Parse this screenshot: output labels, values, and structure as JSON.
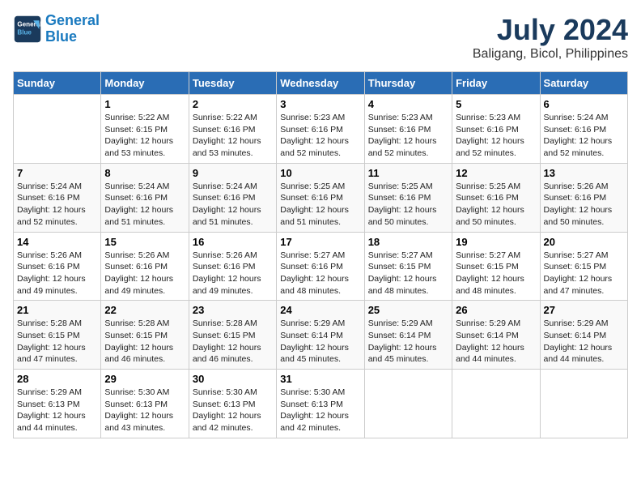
{
  "logo": {
    "line1": "General",
    "line2": "Blue"
  },
  "title": "July 2024",
  "subtitle": "Baligang, Bicol, Philippines",
  "days_header": [
    "Sunday",
    "Monday",
    "Tuesday",
    "Wednesday",
    "Thursday",
    "Friday",
    "Saturday"
  ],
  "weeks": [
    [
      {
        "day": "",
        "sunrise": "",
        "sunset": "",
        "daylight": ""
      },
      {
        "day": "1",
        "sunrise": "Sunrise: 5:22 AM",
        "sunset": "Sunset: 6:15 PM",
        "daylight": "Daylight: 12 hours and 53 minutes."
      },
      {
        "day": "2",
        "sunrise": "Sunrise: 5:22 AM",
        "sunset": "Sunset: 6:16 PM",
        "daylight": "Daylight: 12 hours and 53 minutes."
      },
      {
        "day": "3",
        "sunrise": "Sunrise: 5:23 AM",
        "sunset": "Sunset: 6:16 PM",
        "daylight": "Daylight: 12 hours and 52 minutes."
      },
      {
        "day": "4",
        "sunrise": "Sunrise: 5:23 AM",
        "sunset": "Sunset: 6:16 PM",
        "daylight": "Daylight: 12 hours and 52 minutes."
      },
      {
        "day": "5",
        "sunrise": "Sunrise: 5:23 AM",
        "sunset": "Sunset: 6:16 PM",
        "daylight": "Daylight: 12 hours and 52 minutes."
      },
      {
        "day": "6",
        "sunrise": "Sunrise: 5:24 AM",
        "sunset": "Sunset: 6:16 PM",
        "daylight": "Daylight: 12 hours and 52 minutes."
      }
    ],
    [
      {
        "day": "7",
        "sunrise": "Sunrise: 5:24 AM",
        "sunset": "Sunset: 6:16 PM",
        "daylight": "Daylight: 12 hours and 52 minutes."
      },
      {
        "day": "8",
        "sunrise": "Sunrise: 5:24 AM",
        "sunset": "Sunset: 6:16 PM",
        "daylight": "Daylight: 12 hours and 51 minutes."
      },
      {
        "day": "9",
        "sunrise": "Sunrise: 5:24 AM",
        "sunset": "Sunset: 6:16 PM",
        "daylight": "Daylight: 12 hours and 51 minutes."
      },
      {
        "day": "10",
        "sunrise": "Sunrise: 5:25 AM",
        "sunset": "Sunset: 6:16 PM",
        "daylight": "Daylight: 12 hours and 51 minutes."
      },
      {
        "day": "11",
        "sunrise": "Sunrise: 5:25 AM",
        "sunset": "Sunset: 6:16 PM",
        "daylight": "Daylight: 12 hours and 50 minutes."
      },
      {
        "day": "12",
        "sunrise": "Sunrise: 5:25 AM",
        "sunset": "Sunset: 6:16 PM",
        "daylight": "Daylight: 12 hours and 50 minutes."
      },
      {
        "day": "13",
        "sunrise": "Sunrise: 5:26 AM",
        "sunset": "Sunset: 6:16 PM",
        "daylight": "Daylight: 12 hours and 50 minutes."
      }
    ],
    [
      {
        "day": "14",
        "sunrise": "Sunrise: 5:26 AM",
        "sunset": "Sunset: 6:16 PM",
        "daylight": "Daylight: 12 hours and 49 minutes."
      },
      {
        "day": "15",
        "sunrise": "Sunrise: 5:26 AM",
        "sunset": "Sunset: 6:16 PM",
        "daylight": "Daylight: 12 hours and 49 minutes."
      },
      {
        "day": "16",
        "sunrise": "Sunrise: 5:26 AM",
        "sunset": "Sunset: 6:16 PM",
        "daylight": "Daylight: 12 hours and 49 minutes."
      },
      {
        "day": "17",
        "sunrise": "Sunrise: 5:27 AM",
        "sunset": "Sunset: 6:16 PM",
        "daylight": "Daylight: 12 hours and 48 minutes."
      },
      {
        "day": "18",
        "sunrise": "Sunrise: 5:27 AM",
        "sunset": "Sunset: 6:15 PM",
        "daylight": "Daylight: 12 hours and 48 minutes."
      },
      {
        "day": "19",
        "sunrise": "Sunrise: 5:27 AM",
        "sunset": "Sunset: 6:15 PM",
        "daylight": "Daylight: 12 hours and 48 minutes."
      },
      {
        "day": "20",
        "sunrise": "Sunrise: 5:27 AM",
        "sunset": "Sunset: 6:15 PM",
        "daylight": "Daylight: 12 hours and 47 minutes."
      }
    ],
    [
      {
        "day": "21",
        "sunrise": "Sunrise: 5:28 AM",
        "sunset": "Sunset: 6:15 PM",
        "daylight": "Daylight: 12 hours and 47 minutes."
      },
      {
        "day": "22",
        "sunrise": "Sunrise: 5:28 AM",
        "sunset": "Sunset: 6:15 PM",
        "daylight": "Daylight: 12 hours and 46 minutes."
      },
      {
        "day": "23",
        "sunrise": "Sunrise: 5:28 AM",
        "sunset": "Sunset: 6:15 PM",
        "daylight": "Daylight: 12 hours and 46 minutes."
      },
      {
        "day": "24",
        "sunrise": "Sunrise: 5:29 AM",
        "sunset": "Sunset: 6:14 PM",
        "daylight": "Daylight: 12 hours and 45 minutes."
      },
      {
        "day": "25",
        "sunrise": "Sunrise: 5:29 AM",
        "sunset": "Sunset: 6:14 PM",
        "daylight": "Daylight: 12 hours and 45 minutes."
      },
      {
        "day": "26",
        "sunrise": "Sunrise: 5:29 AM",
        "sunset": "Sunset: 6:14 PM",
        "daylight": "Daylight: 12 hours and 44 minutes."
      },
      {
        "day": "27",
        "sunrise": "Sunrise: 5:29 AM",
        "sunset": "Sunset: 6:14 PM",
        "daylight": "Daylight: 12 hours and 44 minutes."
      }
    ],
    [
      {
        "day": "28",
        "sunrise": "Sunrise: 5:29 AM",
        "sunset": "Sunset: 6:13 PM",
        "daylight": "Daylight: 12 hours and 44 minutes."
      },
      {
        "day": "29",
        "sunrise": "Sunrise: 5:30 AM",
        "sunset": "Sunset: 6:13 PM",
        "daylight": "Daylight: 12 hours and 43 minutes."
      },
      {
        "day": "30",
        "sunrise": "Sunrise: 5:30 AM",
        "sunset": "Sunset: 6:13 PM",
        "daylight": "Daylight: 12 hours and 42 minutes."
      },
      {
        "day": "31",
        "sunrise": "Sunrise: 5:30 AM",
        "sunset": "Sunset: 6:13 PM",
        "daylight": "Daylight: 12 hours and 42 minutes."
      },
      {
        "day": "",
        "sunrise": "",
        "sunset": "",
        "daylight": ""
      },
      {
        "day": "",
        "sunrise": "",
        "sunset": "",
        "daylight": ""
      },
      {
        "day": "",
        "sunrise": "",
        "sunset": "",
        "daylight": ""
      }
    ]
  ]
}
